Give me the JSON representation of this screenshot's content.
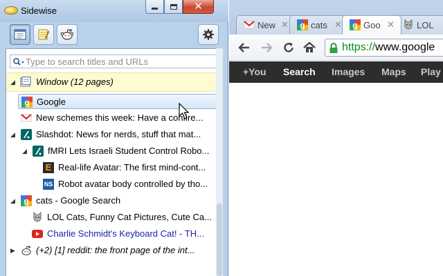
{
  "sidewise": {
    "title": "Sidewise",
    "toolbar": {
      "pages_icon": "pages-icon",
      "notes_icon": "notepad-icon",
      "reddit_icon": "reddit-icon",
      "settings_icon": "gear-icon"
    },
    "search": {
      "placeholder": "Type to search titles and URLs"
    },
    "window_row": {
      "label": "Window (12 pages)"
    },
    "rows": [
      {
        "label": "Google",
        "favicon": "google"
      },
      {
        "label": "New schemes this week: Have a confire...",
        "favicon": "gmail"
      },
      {
        "label": "Slashdot: News for nerds, stuff that mat...",
        "favicon": "slashdot"
      },
      {
        "label": "fMRI Lets Israeli Student Control Robo...",
        "favicon": "slashdot"
      },
      {
        "label": "Real-life Avatar: The first mind-cont...",
        "favicon": "engadget"
      },
      {
        "label": "Robot avatar body controlled by tho...",
        "favicon": "newscientist"
      },
      {
        "label": "cats - Google Search",
        "favicon": "google"
      },
      {
        "label": "LOL Cats, Funny Cat Pictures, Cute Ca...",
        "favicon": "lolcat"
      },
      {
        "label": "Charlie Schmidt's Keyboard Cat! - TH...",
        "favicon": "youtube"
      },
      {
        "label": "(+2) [1] reddit: the front page of the int...",
        "favicon": "reddit"
      }
    ],
    "favicon_labels": {
      "engadget": "E",
      "newscientist": "NS"
    }
  },
  "chrome": {
    "tabs": [
      {
        "label": "New",
        "favicon": "gmail"
      },
      {
        "label": "cats",
        "favicon": "google"
      },
      {
        "label": "Goo",
        "favicon": "google"
      },
      {
        "label": "LOL",
        "favicon": "lolcat"
      }
    ],
    "url": {
      "scheme": "https://",
      "host": "www.google"
    },
    "gbar": [
      "+You",
      "Search",
      "Images",
      "Maps",
      "Play"
    ]
  },
  "colors": {
    "window_frame": "#b9d1ea",
    "window_row_bg": "#fdfbd2",
    "selected_row": "#d6e7fa",
    "gbar_bg": "#2d2d2d",
    "link": "#1a23a8",
    "url_green": "#0b8a1e"
  }
}
